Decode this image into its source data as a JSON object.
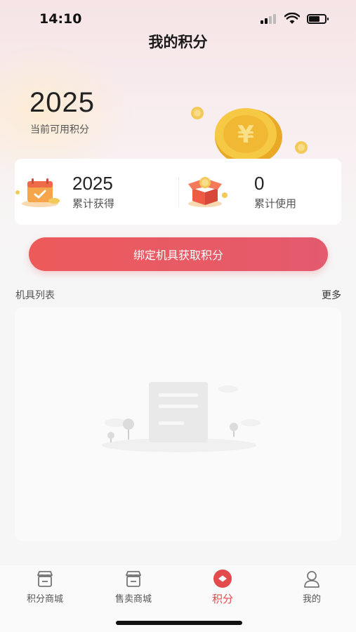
{
  "status_bar": {
    "time": "14:10"
  },
  "header": {
    "title": "我的积分"
  },
  "points": {
    "available": "2025",
    "available_label": "当前可用积分"
  },
  "stats": {
    "earned_value": "2025",
    "earned_label": "累计获得",
    "used_value": "0",
    "used_label": "累计使用"
  },
  "bind_button_label": "绑定机具获取积分",
  "device_section": {
    "title": "机具列表",
    "more_label": "更多"
  },
  "tabs": [
    {
      "label": "积分商城",
      "icon": "store-icon"
    },
    {
      "label": "售卖商城",
      "icon": "shop-icon"
    },
    {
      "label": "积分",
      "icon": "points-icon"
    },
    {
      "label": "我的",
      "icon": "profile-icon"
    }
  ],
  "active_tab": 2,
  "colors": {
    "accent": "#e24b4b",
    "button_start": "#ec5a5a",
    "button_end": "#e45a6e"
  }
}
